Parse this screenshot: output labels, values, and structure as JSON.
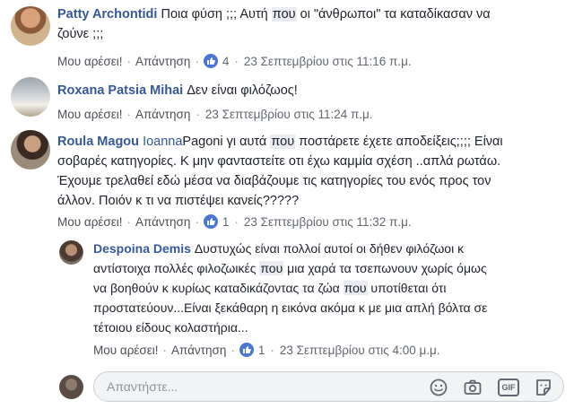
{
  "comments": [
    {
      "author": "Patty Archontidi",
      "text_a": "Ποια φύση ;;; Αυτή ",
      "hl": "που",
      "text_b": " οι \"άνθρωποι\" τα καταδίκασαν να",
      "line2": "ζούνε ;;;",
      "like": "Μου αρέσει!",
      "reply": "Απάντηση",
      "likes": "4",
      "time": "23 Σεπτεμβρίου στις 11:16 π.μ."
    },
    {
      "author": "Roxana Patsia Mihai",
      "text": "Δεν είναι φιλόζωος!",
      "like": "Μου αρέσει!",
      "reply": "Απάντηση",
      "time": "23 Σεπτεμβρίου στις 11:24 π.μ."
    },
    {
      "author": "Roula Magou",
      "mention": "Ioanna",
      "text_a": "Pagoni γι αυτά ",
      "hl": "που",
      "text_b": " ποστάρετε έχετε αποδείξεις;;;; Είναι",
      "line2": "σοβαρές κατηγορίες. Κ μην φανταστείτε οτι έχω καμμία σχέση ..απλά ρωτάω.",
      "line3": "Έχουμε τρελαθεί εδώ μέσα να διαβάζουμε τις κατηγορίες του ενός προς τον",
      "line4": "άλλον. Ποιόν κ τι να πιστέψει κανείς?????",
      "like": "Μου αρέσει!",
      "reply": "Απάντηση",
      "likes": "1",
      "time": "23 Σεπτεμβρίου στις 11:32 π.μ."
    },
    {
      "author": "Despoina Demis",
      "line1": "Δυστυχώς είναι πολλοί αυτοί οι δήθεν φιλόζωοι κ",
      "line2a": "αντίστοιχα πολλές φιλοζωικές ",
      "hl1": "που",
      "line2b": " μια χαρά τα τσεπωνουν χωρίς όμως",
      "line3a": "να βοηθούν κ κυρίως καταδικάζοντας τα ζώα ",
      "hl2": "που",
      "line3b": " υποτίθεται ότι",
      "line4": "προστατεύουν...Είναι ξεκάθαρη η εικόνα ακόμα κ με μια απλή βόλτα σε",
      "line5": "τέτοιου είδους κολαστήρια...",
      "like": "Μου αρέσει!",
      "reply": "Απάντηση",
      "likes": "1",
      "time": "23 Σεπτεμβρίου στις 4:00 μ.μ."
    }
  ],
  "reply_box": {
    "placeholder": "Απαντήστε...",
    "gif_label": "GIF"
  },
  "icons": [
    "thumbs-up-icon",
    "emoji-icon",
    "camera-icon",
    "gif-icon",
    "sticker-icon"
  ],
  "colors": {
    "link": "#365899",
    "like_blue": "#4a76d8",
    "highlight": "#e9ebf0"
  }
}
